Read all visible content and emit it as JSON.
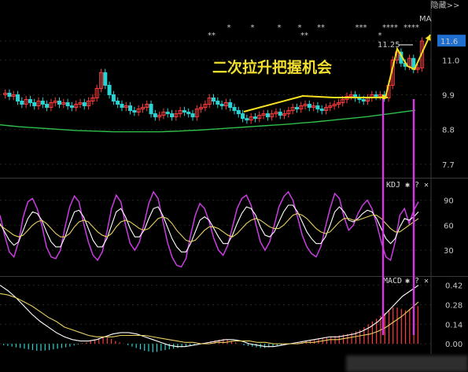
{
  "ui": {
    "hide_label": "隐藏>>",
    "caption": "二次拉升把握机会",
    "ma_label": "MA",
    "kdj_label": "KDJ",
    "macd_label": "MACD",
    "gear_glyph": "✱",
    "help_glyph": "?",
    "close_glyph": "✕",
    "colors": {
      "background": "#000000",
      "up": "#ff3b3b",
      "down": "#2ad4d4",
      "ma_long": "#2fbf4a",
      "annotation": "#f5e020",
      "marker_line": "#d23be0",
      "kdj_j": "#c93de0",
      "kdj_k": "#ffffff",
      "kdj_d": "#e8d060",
      "current_price_bg": "#1f6fd0"
    }
  },
  "chart_data": [
    {
      "type": "candlestick",
      "title": "",
      "y_ticks": [
        "11.6",
        "11.0",
        "9.9",
        "8.8",
        "7.7"
      ],
      "current_price": "11.6",
      "annotated_price": "11.25",
      "ylim": [
        7.3,
        12.4
      ],
      "closes": [
        9.95,
        9.85,
        9.9,
        9.7,
        9.6,
        9.75,
        9.65,
        9.55,
        9.7,
        9.6,
        9.5,
        9.65,
        9.7,
        9.6,
        9.65,
        9.55,
        9.5,
        9.6,
        9.65,
        9.55,
        9.7,
        9.8,
        10.1,
        10.6,
        10.2,
        9.9,
        9.7,
        9.6,
        9.5,
        9.55,
        9.4,
        9.35,
        9.45,
        9.5,
        9.6,
        9.3,
        9.2,
        9.25,
        9.35,
        9.3,
        9.2,
        9.3,
        9.4,
        9.35,
        9.3,
        9.2,
        9.45,
        9.5,
        9.6,
        9.8,
        9.7,
        9.6,
        9.55,
        9.65,
        9.5,
        9.4,
        9.3,
        9.15,
        9.1,
        9.2,
        9.15,
        9.25,
        9.3,
        9.2,
        9.3,
        9.35,
        9.25,
        9.3,
        9.4,
        9.5,
        9.45,
        9.55,
        9.6,
        9.5,
        9.55,
        9.45,
        9.4,
        9.5,
        9.55,
        9.6,
        9.65,
        9.75,
        9.85,
        9.9,
        9.8,
        9.75,
        9.7,
        9.8,
        9.9,
        9.85,
        9.9,
        9.8,
        10.2,
        11.0,
        11.25,
        10.9,
        10.8,
        11.05,
        10.7,
        10.75,
        11.6
      ],
      "ma_long": [
        8.95,
        8.92,
        8.89,
        8.87,
        8.85,
        8.83,
        8.81,
        8.79,
        8.77,
        8.76,
        8.75,
        8.74,
        8.73,
        8.73,
        8.73,
        8.73,
        8.73,
        8.73,
        8.74,
        8.75,
        8.77,
        8.78,
        8.8,
        8.82,
        8.84,
        8.86,
        8.88,
        8.9,
        8.92,
        8.94,
        8.96,
        8.98,
        9.01,
        9.03,
        9.06,
        9.09,
        9.12,
        9.15,
        9.18,
        9.21,
        9.25,
        9.29,
        9.33,
        9.37,
        9.41
      ],
      "star_markers": [
        "*",
        "**",
        "*",
        "*",
        "*",
        "**",
        "**",
        "***",
        "****",
        "****",
        "*"
      ]
    },
    {
      "type": "line",
      "name": "KDJ",
      "y_ticks": [
        "90",
        "60",
        "30"
      ],
      "ylim": [
        0,
        115
      ],
      "series": [
        {
          "name": "J",
          "values": [
            72,
            48,
            28,
            22,
            40,
            70,
            88,
            92,
            80,
            60,
            34,
            22,
            20,
            30,
            58,
            82,
            95,
            88,
            62,
            40,
            24,
            18,
            28,
            52,
            80,
            96,
            88,
            60,
            38,
            30,
            40,
            62,
            86,
            100,
            92,
            66,
            40,
            22,
            12,
            10,
            20,
            48,
            72,
            86,
            80,
            64,
            44,
            30,
            24,
            36,
            58,
            80,
            92,
            96,
            84,
            62,
            40,
            30,
            40,
            60,
            82,
            94,
            100,
            90,
            70,
            48,
            34,
            26,
            22,
            34,
            58,
            80,
            98,
            92,
            70,
            54,
            60,
            74,
            84,
            90,
            80,
            62,
            40,
            22,
            18,
            40,
            72,
            80,
            62,
            78,
            88
          ]
        },
        {
          "name": "K",
          "values": [
            62,
            52,
            42,
            36,
            40,
            54,
            68,
            76,
            74,
            66,
            52,
            40,
            34,
            34,
            46,
            62,
            76,
            78,
            70,
            56,
            42,
            34,
            34,
            44,
            60,
            76,
            80,
            70,
            56,
            46,
            46,
            54,
            68,
            80,
            82,
            72,
            58,
            44,
            34,
            28,
            28,
            38,
            52,
            66,
            70,
            66,
            56,
            46,
            38,
            38,
            48,
            62,
            74,
            82,
            80,
            72,
            58,
            48,
            46,
            52,
            64,
            76,
            84,
            84,
            76,
            64,
            52,
            44,
            38,
            38,
            46,
            60,
            76,
            82,
            76,
            66,
            64,
            68,
            74,
            78,
            76,
            68,
            56,
            44,
            38,
            44,
            58,
            68,
            66,
            70,
            76
          ]
        },
        {
          "name": "D",
          "values": [
            60,
            56,
            52,
            48,
            46,
            48,
            54,
            60,
            64,
            66,
            62,
            56,
            50,
            46,
            46,
            50,
            58,
            64,
            66,
            64,
            58,
            52,
            48,
            46,
            50,
            58,
            64,
            66,
            64,
            60,
            56,
            54,
            56,
            62,
            68,
            70,
            68,
            62,
            54,
            48,
            42,
            40,
            42,
            48,
            54,
            58,
            58,
            56,
            52,
            48,
            46,
            50,
            56,
            62,
            66,
            68,
            66,
            62,
            58,
            56,
            56,
            60,
            66,
            72,
            74,
            72,
            68,
            62,
            56,
            52,
            50,
            52,
            58,
            64,
            68,
            68,
            66,
            66,
            68,
            70,
            72,
            72,
            68,
            62,
            56,
            52,
            52,
            56,
            60,
            64,
            68
          ]
        }
      ]
    },
    {
      "type": "bar",
      "name": "MACD",
      "y_ticks": [
        "0.42",
        "0.28",
        "0.14",
        "0.00"
      ],
      "ylim": [
        -0.05,
        0.48
      ],
      "histogram": [
        -0.01,
        -0.015,
        -0.02,
        -0.025,
        -0.03,
        -0.035,
        -0.04,
        -0.045,
        -0.05,
        -0.05,
        -0.048,
        -0.045,
        -0.04,
        -0.035,
        -0.03,
        -0.025,
        -0.02,
        -0.012,
        -0.005,
        0.005,
        0.01,
        0.02,
        0.03,
        0.04,
        0.05,
        0.045,
        0.035,
        0.02,
        0.01,
        0.0,
        -0.01,
        -0.02,
        -0.03,
        -0.04,
        -0.05,
        -0.055,
        -0.06,
        -0.058,
        -0.05,
        -0.045,
        -0.04,
        -0.035,
        -0.03,
        -0.025,
        -0.02,
        -0.015,
        -0.01,
        0.0,
        0.005,
        0.01,
        0.02,
        0.025,
        0.03,
        0.035,
        0.03,
        0.02,
        0.01,
        0.0,
        -0.01,
        -0.015,
        -0.02,
        -0.025,
        -0.03,
        -0.03,
        -0.025,
        -0.02,
        -0.015,
        -0.01,
        -0.005,
        0.0,
        0.005,
        0.01,
        0.015,
        0.02,
        0.025,
        0.03,
        0.035,
        0.04,
        0.045,
        0.05,
        0.055,
        0.06,
        0.065,
        0.07,
        0.08,
        0.09,
        0.1,
        0.12,
        0.14,
        0.16,
        0.18,
        0.2,
        0.22,
        0.24,
        0.26,
        0.26,
        0.25,
        0.24,
        0.25,
        0.26,
        0.27
      ],
      "series": [
        {
          "name": "DIF",
          "values": [
            0.42,
            0.38,
            0.33,
            0.27,
            0.21,
            0.16,
            0.12,
            0.08,
            0.05,
            0.03,
            0.02,
            0.02,
            0.03,
            0.05,
            0.07,
            0.08,
            0.08,
            0.07,
            0.05,
            0.03,
            0.01,
            -0.01,
            -0.02,
            -0.02,
            -0.01,
            0.0,
            0.01,
            0.02,
            0.03,
            0.03,
            0.02,
            0.0,
            -0.01,
            -0.02,
            -0.02,
            -0.01,
            0.0,
            0.01,
            0.02,
            0.03,
            0.04,
            0.05,
            0.05,
            0.06,
            0.07,
            0.09,
            0.12,
            0.16,
            0.22,
            0.28,
            0.34,
            0.38,
            0.42
          ]
        },
        {
          "name": "DEA",
          "values": [
            0.36,
            0.35,
            0.33,
            0.3,
            0.27,
            0.23,
            0.19,
            0.16,
            0.12,
            0.1,
            0.08,
            0.06,
            0.05,
            0.05,
            0.05,
            0.06,
            0.06,
            0.06,
            0.06,
            0.05,
            0.04,
            0.03,
            0.02,
            0.01,
            0.01,
            0.0,
            0.0,
            0.01,
            0.01,
            0.02,
            0.02,
            0.02,
            0.01,
            0.01,
            0.0,
            0.0,
            0.0,
            0.0,
            0.01,
            0.01,
            0.02,
            0.03,
            0.03,
            0.04,
            0.05,
            0.06,
            0.07,
            0.09,
            0.12,
            0.16,
            0.2,
            0.25,
            0.3
          ]
        }
      ]
    }
  ]
}
